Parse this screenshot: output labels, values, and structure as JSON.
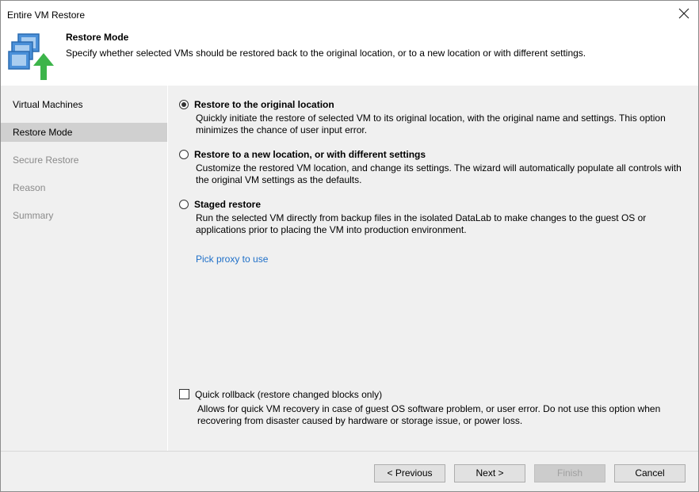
{
  "window": {
    "title": "Entire VM Restore"
  },
  "header": {
    "title": "Restore Mode",
    "subtitle": "Specify whether selected VMs should be restored back to the original location, or to a new location or with different settings."
  },
  "sidebar": {
    "items": [
      {
        "label": "Virtual Machines",
        "state": "enabled"
      },
      {
        "label": "Restore Mode",
        "state": "active"
      },
      {
        "label": "Secure Restore",
        "state": "disabled"
      },
      {
        "label": "Reason",
        "state": "disabled"
      },
      {
        "label": "Summary",
        "state": "disabled"
      }
    ]
  },
  "options": [
    {
      "label": "Restore to the original location",
      "description": "Quickly initiate the restore of selected VM to its original location, with the original name and settings. This option minimizes the chance of user input error.",
      "selected": true
    },
    {
      "label": "Restore to a new location, or with different settings",
      "description": "Customize the restored VM location, and change its settings. The wizard will automatically populate all controls with the original VM settings as the defaults.",
      "selected": false
    },
    {
      "label": "Staged restore",
      "description": "Run the selected VM directly from backup files in the isolated DataLab to make changes to the guest OS or applications prior to placing the VM into production environment.",
      "selected": false
    }
  ],
  "pick_proxy_link": "Pick proxy to use",
  "quick_rollback": {
    "label": "Quick rollback (restore changed blocks only)",
    "description": "Allows for quick VM recovery in case of guest OS software problem, or user error. Do not use this option when recovering from disaster caused by hardware or storage issue, or power loss.",
    "checked": false
  },
  "buttons": {
    "previous": "< Previous",
    "next": "Next >",
    "finish": "Finish",
    "cancel": "Cancel"
  },
  "colors": {
    "link": "#1e6fc8",
    "arrow": "#3cb44a",
    "monitor": "#4a90d9"
  }
}
